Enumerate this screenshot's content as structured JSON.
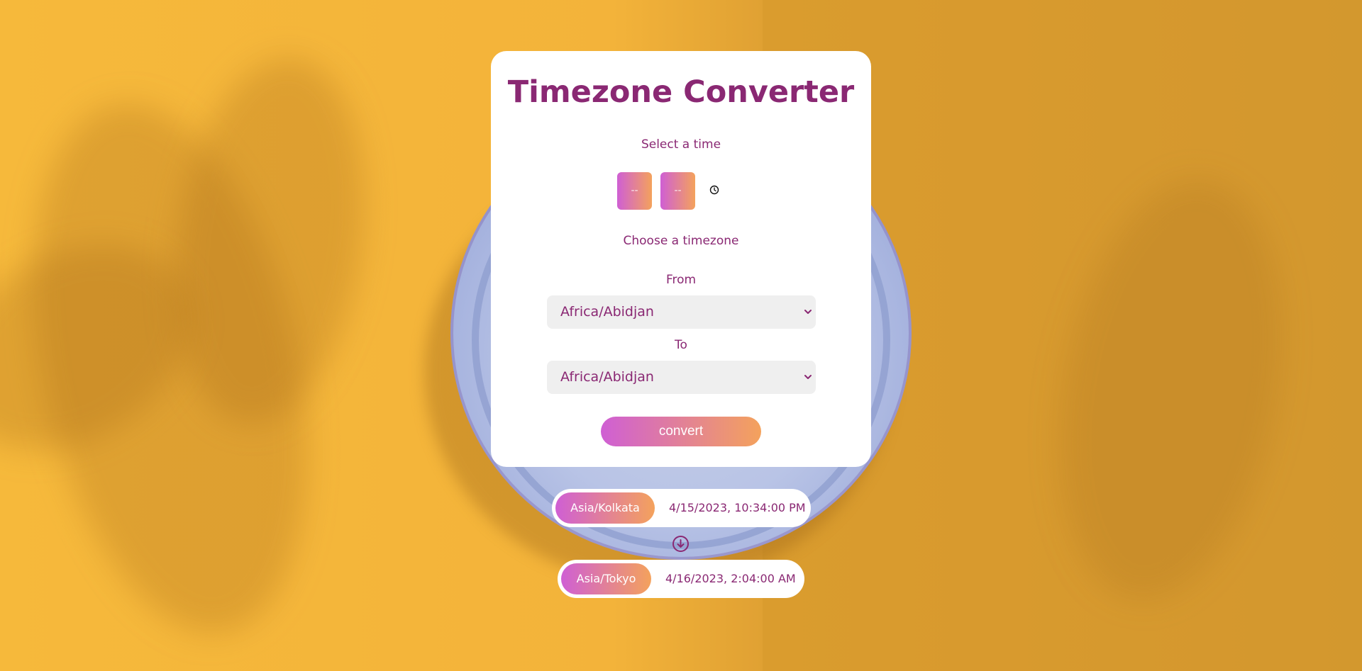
{
  "app": {
    "title": "Timezone Converter"
  },
  "time_picker": {
    "label": "Select a time",
    "hour_placeholder": "--",
    "minute_placeholder": "--",
    "clock_icon": "clock-icon"
  },
  "timezone": {
    "label": "Choose a timezone",
    "from_label": "From",
    "from_value": "Africa/Abidjan",
    "to_label": "To",
    "to_value": "Africa/Abidjan"
  },
  "convert_button": {
    "label": "convert"
  },
  "results": {
    "source": {
      "timezone": "Asia/Kolkata",
      "datetime": "4/15/2023, 10:34:00 PM"
    },
    "arrow_icon": "arrow-down-circle-icon",
    "target": {
      "timezone": "Asia/Tokyo",
      "datetime": "4/16/2023, 2:04:00 AM"
    }
  },
  "colors": {
    "accent_text": "#8a2873",
    "gradient_start": "#cf5fd4",
    "gradient_end": "#f4a25c",
    "background": "#f6b93b"
  }
}
